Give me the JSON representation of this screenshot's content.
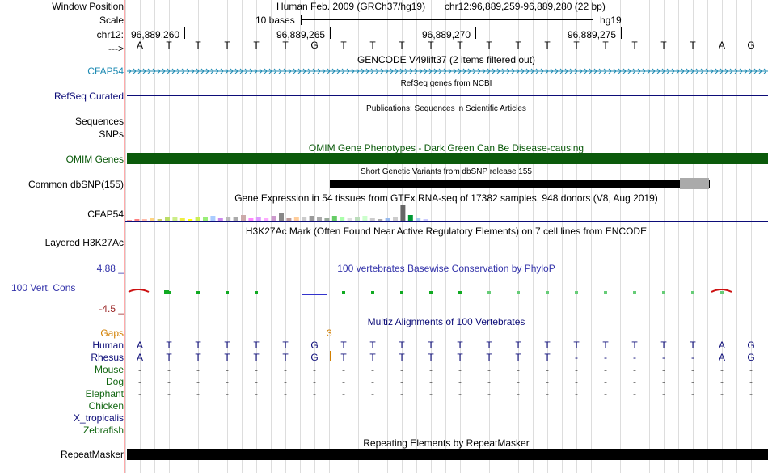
{
  "header": {
    "window_position_label": "Window Position",
    "scale_label": "Scale",
    "chrom_label": "chr12:",
    "arrow_label": "--->",
    "assembly_text": "Human Feb. 2009 (GRCh37/hg19)",
    "position_text": "chr12:96,889,259-96,889,280 (22 bp)",
    "scale_text": "10 bases",
    "scale_assembly": "hg19",
    "coordinates": [
      "96,889,260",
      "96,889,265",
      "96,889,270",
      "96,889,275"
    ]
  },
  "sequence": [
    "A",
    "T",
    "T",
    "T",
    "T",
    "T",
    "G",
    "T",
    "T",
    "T",
    "T",
    "T",
    "T",
    "T",
    "T",
    "T",
    "T",
    "T",
    "T",
    "T",
    "A",
    "G"
  ],
  "tracks": {
    "gencode": {
      "title": "GENCODE V49lift37 (2 items filtered out)",
      "label": "CFAP54",
      "color": "#1f8bb3"
    },
    "refseq": {
      "title": "RefSeq genes from NCBI",
      "label": "RefSeq Curated",
      "color": "#0c0c78"
    },
    "publications": {
      "title": "Publications: Sequences in Scientific Articles",
      "label_line1": "Sequences",
      "label_line2": "SNPs"
    },
    "omim": {
      "title": "OMIM Gene Phenotypes - Dark Green Can Be Disease-causing",
      "label": "OMIM Genes",
      "color": "#0b5a0b"
    },
    "dbsnp": {
      "title": "Short Genetic Variants from dbSNP release 155",
      "label": "Common dbSNP(155)"
    },
    "gtex": {
      "title": "Gene Expression in 54 tissues from GTEx RNA-seq of 17382 samples, 948 donors (V8, Aug 2019)",
      "label": "CFAP54",
      "bar_colors": [
        "#ffa3a3",
        "#ff8080",
        "#ffbbaa",
        "#ffd580",
        "#cccc66",
        "#bbdd66",
        "#ccee88",
        "#eeee44",
        "#ffff00",
        "#ccee55",
        "#99ee77",
        "#aaccff",
        "#cc88ee",
        "#bbbbbb",
        "#aaaaaa",
        "#ccaaaa",
        "#ff88ff",
        "#dd99ff",
        "#ffaaff",
        "#cc99cc",
        "#888888",
        "#bb9999",
        "#ffcc99",
        "#cccccc",
        "#999999",
        "#aaaaaa",
        "#99aa99",
        "#66cc66",
        "#aaffaa",
        "#dddddd",
        "#bbddbb",
        "#ccffcc",
        "#cccccc",
        "#aaaaaa",
        "#99bbee",
        "#cccccc",
        "#666666",
        "#009933",
        "#aaccee",
        "#ccccff"
      ],
      "bar_heights": [
        1,
        2,
        2,
        3,
        2,
        4,
        4,
        3,
        2,
        5,
        4,
        6,
        3,
        4,
        4,
        7,
        3,
        5,
        3,
        6,
        10,
        3,
        5,
        4,
        6,
        5,
        3,
        6,
        4,
        3,
        4,
        6,
        3,
        2,
        3,
        4,
        20,
        7,
        3,
        2
      ]
    },
    "h3k27ac": {
      "title": "H3K27Ac Mark (Often Found Near Active Regulatory Elements) on 7 cell lines from ENCODE",
      "label": "Layered H3K27Ac",
      "line_color": "#7a1a5a"
    },
    "conservation": {
      "title": "100 vertebrates Basewise Conservation by PhyloP",
      "label": "100 Vert. Cons",
      "max_label": "4.88 _",
      "min_label": "-4.5 _",
      "label_color": "#3333aa",
      "min_color": "#992222"
    },
    "multiz": {
      "title": "Multiz Alignments of 100 Vertebrates",
      "gaps_label": "Gaps",
      "gap_count": "3",
      "species": [
        {
          "name": "Human",
          "color": "#0c0c78",
          "bases": [
            "A",
            "T",
            "T",
            "T",
            "T",
            "T",
            "G",
            "T",
            "T",
            "T",
            "T",
            "T",
            "T",
            "T",
            "T",
            "T",
            "T",
            "T",
            "T",
            "T",
            "A",
            "G"
          ]
        },
        {
          "name": "Rhesus",
          "color": "#0c0c78",
          "bases": [
            "A",
            "T",
            "T",
            "T",
            "T",
            "T",
            "G",
            "T",
            "T",
            "T",
            "T",
            "T",
            "T",
            "T",
            "T",
            "-",
            "-",
            "-",
            "-",
            "-",
            "A",
            "G"
          ]
        },
        {
          "name": "Mouse",
          "color": "#116611",
          "bases": [
            "-",
            "-",
            "-",
            "-",
            "-",
            "-",
            "-",
            "-",
            "-",
            "-",
            "-",
            "-",
            "-",
            "-",
            "-",
            "-",
            "-",
            "-",
            "-",
            "-",
            "-",
            "-"
          ]
        },
        {
          "name": "Dog",
          "color": "#116611",
          "bases": [
            "-",
            "-",
            "-",
            "-",
            "-",
            "-",
            "-",
            "-",
            "-",
            "-",
            "-",
            "-",
            "-",
            "-",
            "-",
            "-",
            "-",
            "-",
            "-",
            "-",
            "-",
            "-"
          ]
        },
        {
          "name": "Elephant",
          "color": "#116611",
          "bases": [
            "-",
            "-",
            "-",
            "-",
            "-",
            "-",
            "-",
            "-",
            "-",
            "-",
            "-",
            "-",
            "-",
            "-",
            "-",
            "-",
            "-",
            "-",
            "-",
            "-",
            "-",
            "-"
          ]
        },
        {
          "name": "Chicken",
          "color": "#116611",
          "bases": []
        },
        {
          "name": "X_tropicalis",
          "color": "#0c0c78",
          "bases": []
        },
        {
          "name": "Zebrafish",
          "color": "#116611",
          "bases": []
        }
      ]
    },
    "repeatmasker": {
      "title": "Repeating Elements by RepeatMasker",
      "label": "RepeatMasker"
    }
  },
  "colors": {
    "guide_line": "#d8d8ec",
    "left_border": "#ffaaaa",
    "gap_color": "#d27f00"
  }
}
